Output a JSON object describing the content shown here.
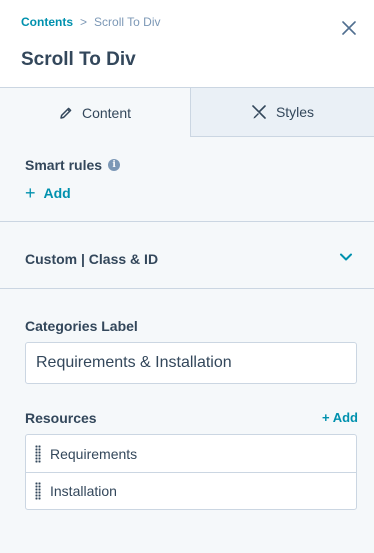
{
  "header": {
    "breadcrumb_parent": "Contents",
    "breadcrumb_separator": ">",
    "breadcrumb_current": "Scroll To Div",
    "title": "Scroll To Div"
  },
  "tabs": [
    {
      "label": "Content",
      "icon": "pencil-icon",
      "active": true
    },
    {
      "label": "Styles",
      "icon": "brush-icon",
      "active": false
    }
  ],
  "smart_rules": {
    "label": "Smart rules",
    "add_label": "Add"
  },
  "accordion": {
    "title": "Custom | Class & ID"
  },
  "categories": {
    "label": "Categories Label",
    "value": "Requirements & Installation"
  },
  "resources": {
    "label": "Resources",
    "add_label": "+ Add",
    "items": [
      {
        "label": "Requirements"
      },
      {
        "label": "Installation"
      }
    ]
  },
  "colors": {
    "accent": "#0091ae",
    "text": "#33475b",
    "border": "#cbd6e2",
    "panel_bg": "#f5f8fa",
    "inactive_tab_bg": "#eaf0f6"
  }
}
